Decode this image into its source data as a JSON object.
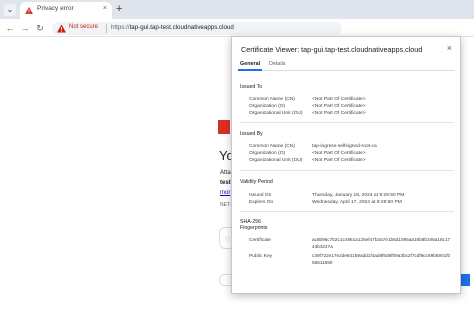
{
  "browser": {
    "tab_menu_icon": "chevron-down-icon",
    "tab": {
      "title": "Privacy error",
      "favicon": "warning-icon",
      "close": "×"
    },
    "new_tab": "+",
    "toolbar": {
      "back": "←",
      "forward": "→",
      "reload": "↻"
    },
    "omnibox": {
      "security_label": "Not secure",
      "url_scheme": "https://",
      "url_host": "tap-gui.tap-test.cloudnativeapps.cloud"
    }
  },
  "error_page": {
    "heading": "Yo",
    "line1": "Atta",
    "line2": "test",
    "line3": "mor",
    "code": "NET::"
  },
  "dialog": {
    "title": "Certificate Viewer: tap-gui.tap-test.cloudnativeapps.cloud",
    "close": "×",
    "tabs": [
      "General",
      "Details"
    ],
    "issued_to": {
      "heading": "Issued To",
      "fields": [
        {
          "label": "Common Name (CN)",
          "value": "<Not Part Of Certificate>"
        },
        {
          "label": "Organization (O)",
          "value": "<Not Part Of Certificate>"
        },
        {
          "label": "Organizational Unit (OU)",
          "value": "<Not Part Of Certificate>"
        }
      ]
    },
    "issued_by": {
      "heading": "Issued By",
      "fields": [
        {
          "label": "Common Name (CN)",
          "value": "tap-ingress-selfsigned-root-ca"
        },
        {
          "label": "Organization (O)",
          "value": "<Not Part Of Certificate>"
        },
        {
          "label": "Organizational Unit (OU)",
          "value": "<Not Part Of Certificate>"
        }
      ]
    },
    "validity": {
      "heading": "Validity Period",
      "fields": [
        {
          "label": "Issued On",
          "value": "Thursday, January 18, 2024 at 9:29:50 PM"
        },
        {
          "label": "Expires On",
          "value": "Wednesday, April 17, 2024 at 9:29:50 PM"
        }
      ]
    },
    "fingerprints": {
      "heading_line1": "SHA-256",
      "heading_line2": "Fingerprints",
      "fields": [
        {
          "label": "Certificate",
          "value": "ac8b96c7b2c1c4861a125ef47b3a7e1b5d1095aa16b8b346a18c1743b3247a"
        },
        {
          "label": "Public Key",
          "value": "c39f722e17e2de84159add1f4ad8f6d6f09a3bc2f7cdf9cc69b5901f058611590"
        }
      ]
    }
  }
}
